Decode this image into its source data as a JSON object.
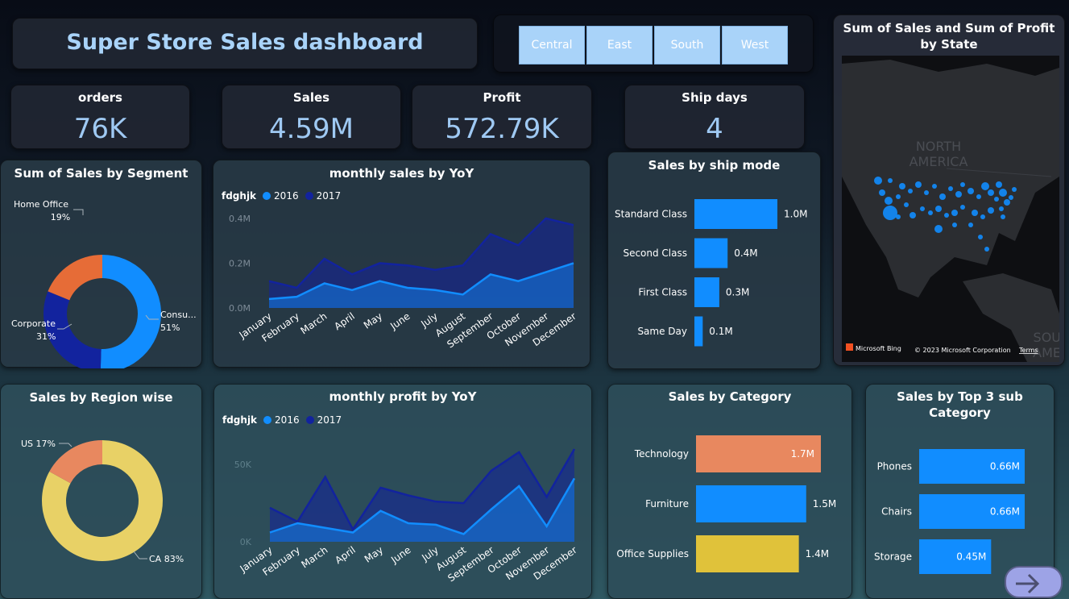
{
  "title": "Super Store Sales dashboard",
  "slicer": [
    "Central",
    "East",
    "South",
    "West"
  ],
  "kpis": {
    "orders": {
      "label": "orders",
      "value": "76K"
    },
    "sales": {
      "label": "Sales",
      "value": "4.59M"
    },
    "profit": {
      "label": "Profit",
      "value": "572.79K"
    },
    "ship_days": {
      "label": "Ship days",
      "value": "4"
    }
  },
  "segment_chart": {
    "title": "Sum of Sales by Segment",
    "labels": [
      {
        "name": "Home Office",
        "pct": "19%"
      },
      {
        "name": "Consu...",
        "pct": "51%"
      },
      {
        "name": "Corporate",
        "pct": "31%"
      }
    ]
  },
  "region_chart": {
    "title": "Sales by Region wise",
    "labels": [
      {
        "name": "US 17%"
      },
      {
        "name": "CA 83%"
      }
    ]
  },
  "monthly_sales": {
    "title": "monthly sales by YoY",
    "legend_title": "fdghjk",
    "legend": [
      "2016",
      "2017"
    ],
    "yticks": [
      "0.4M",
      "0.2M",
      "0.0M"
    ]
  },
  "monthly_profit": {
    "title": "monthly profit by YoY",
    "legend_title": "fdghjk",
    "legend": [
      "2016",
      "2017"
    ],
    "yticks": [
      "50K",
      "0K"
    ]
  },
  "ship_mode": {
    "title": "Sales by ship mode",
    "data_labels": [
      "1.0M",
      "0.4M",
      "0.3M",
      "0.1M"
    ]
  },
  "category": {
    "title": "Sales by Category",
    "data_labels": [
      "1.7M",
      "1.5M",
      "1.4M"
    ]
  },
  "subcategory": {
    "title": "Sales by Top 3 sub Category",
    "data_labels": [
      "0.66M",
      "0.66M",
      "0.45M"
    ]
  },
  "map": {
    "title": "Sum of Sales and Sum of Profit by State",
    "label_na": "NORTH AMERICA",
    "label_sa": "SOU\nAME",
    "bing": "Microsoft Bing",
    "copyright": "© 2023 Microsoft Corporation",
    "terms": "Terms"
  },
  "colors": {
    "blue_2016": "#118dff",
    "navy_2017": "#12239e",
    "orange": "#e66c37",
    "yellow": "#e8d166",
    "salmon": "#e8885f",
    "mustard": "#e0c23a",
    "value_text": "#9fc9f3"
  },
  "chart_data": [
    {
      "type": "pie",
      "title": "Sum of Sales by Segment",
      "categories": [
        "Consumer",
        "Corporate",
        "Home Office"
      ],
      "values": [
        51,
        31,
        19
      ]
    },
    {
      "type": "pie",
      "title": "Sales by Region wise",
      "categories": [
        "CA",
        "US"
      ],
      "values": [
        83,
        17
      ]
    },
    {
      "type": "area",
      "title": "monthly sales by YoY",
      "categories": [
        "January",
        "February",
        "March",
        "April",
        "May",
        "June",
        "July",
        "August",
        "September",
        "October",
        "November",
        "December"
      ],
      "ylim": [
        0,
        0.45
      ],
      "series": [
        {
          "name": "2016",
          "values": [
            0.04,
            0.05,
            0.11,
            0.08,
            0.12,
            0.09,
            0.08,
            0.06,
            0.15,
            0.12,
            0.16,
            0.2
          ]
        },
        {
          "name": "2017",
          "values": [
            0.12,
            0.09,
            0.22,
            0.15,
            0.2,
            0.19,
            0.17,
            0.19,
            0.33,
            0.28,
            0.4,
            0.37
          ]
        }
      ]
    },
    {
      "type": "area",
      "title": "monthly profit by YoY",
      "categories": [
        "January",
        "February",
        "March",
        "April",
        "May",
        "June",
        "July",
        "August",
        "September",
        "October",
        "November",
        "December"
      ],
      "ylim": [
        0,
        60
      ],
      "series": [
        {
          "name": "2016",
          "values": [
            6,
            12,
            9,
            6,
            20,
            12,
            11,
            5,
            21,
            36,
            10,
            41
          ]
        },
        {
          "name": "2017",
          "values": [
            22,
            13,
            42,
            8,
            35,
            30,
            26,
            25,
            46,
            58,
            29,
            60
          ]
        }
      ]
    },
    {
      "type": "bar",
      "title": "Sales by ship mode",
      "categories": [
        "Standard Class",
        "Second Class",
        "First Class",
        "Same Day"
      ],
      "values": [
        1.0,
        0.4,
        0.3,
        0.1
      ]
    },
    {
      "type": "bar",
      "title": "Sales by Category",
      "categories": [
        "Technology",
        "Furniture",
        "Office Supplies"
      ],
      "values": [
        1.7,
        1.5,
        1.4
      ]
    },
    {
      "type": "bar",
      "title": "Sales by Top 3 sub Category",
      "categories": [
        "Phones",
        "Chairs",
        "Storage"
      ],
      "values": [
        0.66,
        0.66,
        0.45
      ]
    }
  ]
}
